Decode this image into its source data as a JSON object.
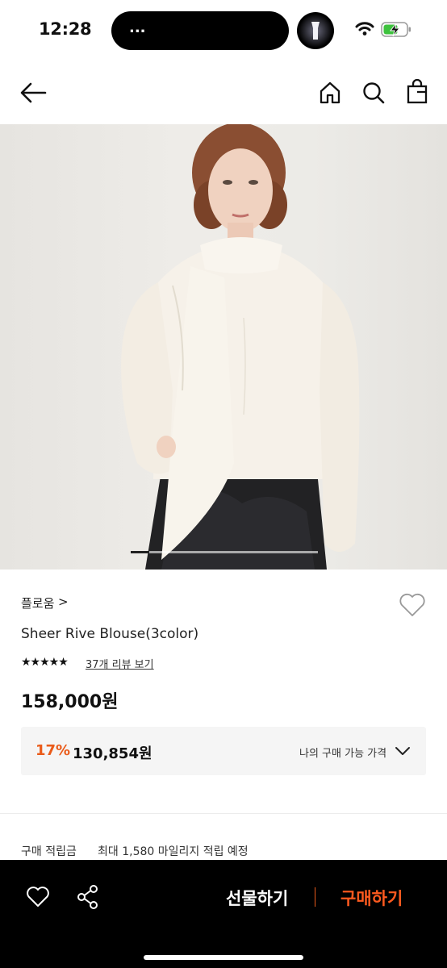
{
  "status_bar": {
    "time": "12:28",
    "island_text": "...",
    "icons": [
      "flashlight-icon",
      "wifi-icon",
      "battery-charging-icon"
    ]
  },
  "nav": {
    "icons": [
      "back-arrow-icon",
      "home-icon",
      "search-icon",
      "shopping-bag-icon"
    ]
  },
  "hero": {
    "image_count_shown": "product photo carousel",
    "active_slide_fraction": 0.1
  },
  "product": {
    "brand": "플로움",
    "brand_chevron": ">",
    "name": "Sheer Rive Blouse(3color)",
    "rating_stars": "★★★★★",
    "rating_value": 4.5,
    "reviews_link": "37개 리뷰 보기",
    "price": "158,000원"
  },
  "member_price": {
    "discount_rate": "17%",
    "discount_price": "130,854원",
    "label": "나의 구매 가능 가격"
  },
  "points": {
    "label": "구매 적립금",
    "value": "최대 1,580 마일리지 적립 예정"
  },
  "bottom_bar": {
    "gift_label": "선물하기",
    "buy_label": "구매하기"
  },
  "colors": {
    "accent": "#ea5b1a",
    "bottom_bar_bg": "#000000"
  }
}
